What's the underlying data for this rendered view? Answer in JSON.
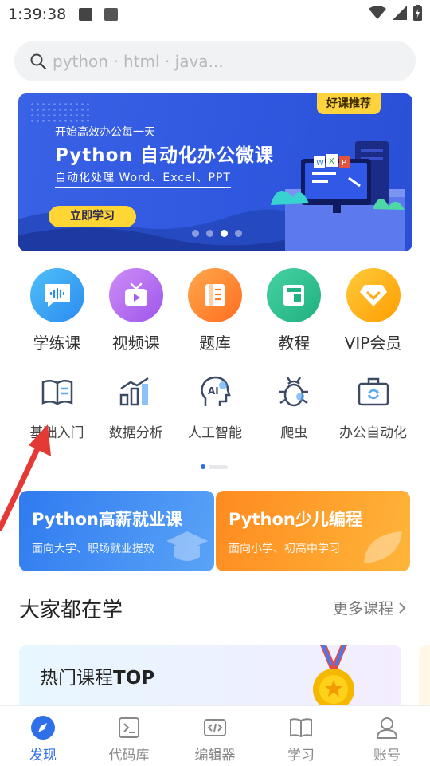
{
  "status": {
    "time": "1:39:38"
  },
  "search": {
    "placeholder": "python · html · java..."
  },
  "banner": {
    "tag": "好课推荐",
    "slogan": "开始高效办公每一天",
    "title": "Python 自动化办公微课",
    "subtitle": "自动化处理 Word、Excel、PPT",
    "cta": "立即学习",
    "slides": 4,
    "active_slide": 3
  },
  "categories_primary": [
    {
      "label": "学练课",
      "icon": "chat-bubble-icon",
      "color": "#3aa2f3"
    },
    {
      "label": "视频课",
      "icon": "tv-icon",
      "color": "#b76cf2"
    },
    {
      "label": "题库",
      "icon": "question-bank-icon",
      "color": "#ff8a2a"
    },
    {
      "label": "教程",
      "icon": "tutorial-book-icon",
      "color": "#2fbf8f"
    },
    {
      "label": "VIP会员",
      "icon": "diamond-icon",
      "color": "#ffb21a"
    }
  ],
  "categories_secondary": [
    {
      "label": "基础入门",
      "icon": "open-book-icon"
    },
    {
      "label": "数据分析",
      "icon": "bar-chart-icon"
    },
    {
      "label": "人工智能",
      "icon": "ai-head-icon"
    },
    {
      "label": "爬虫",
      "icon": "bug-icon"
    },
    {
      "label": "办公自动化",
      "icon": "briefcase-icon"
    }
  ],
  "promos": [
    {
      "title": "Python高薪就业课",
      "subtitle": "面向大学、职场就业提效"
    },
    {
      "title": "Python少儿编程",
      "subtitle": "面向小学、初高中学习"
    }
  ],
  "section": {
    "title": "大家都在学",
    "more": "更多课程"
  },
  "top_card": {
    "title_prefix": "热门课程",
    "title_suffix": "TOP"
  },
  "bottom_nav": [
    {
      "label": "发现",
      "icon": "compass-icon",
      "active": true
    },
    {
      "label": "代码库",
      "icon": "terminal-icon",
      "active": false
    },
    {
      "label": "编辑器",
      "icon": "code-editor-icon",
      "active": false
    },
    {
      "label": "学习",
      "icon": "study-book-icon",
      "active": false
    },
    {
      "label": "账号",
      "icon": "user-icon",
      "active": false
    }
  ],
  "colors": {
    "brand_blue": "#2f6fe8",
    "annotation_red": "#e53935"
  }
}
